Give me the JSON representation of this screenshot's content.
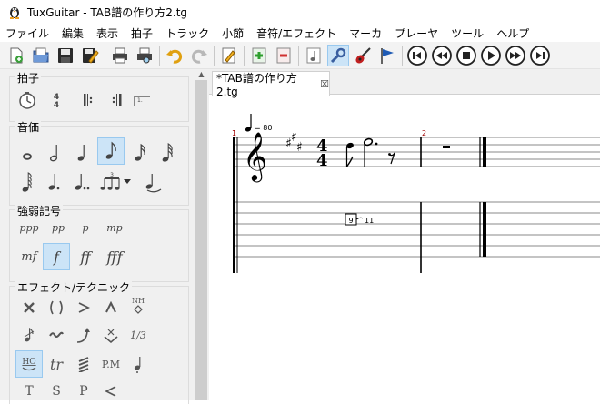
{
  "window": {
    "title": "TuxGuitar - TAB譜の作り方2.tg"
  },
  "menu": [
    "ファイル",
    "編集",
    "表示",
    "拍子",
    "トラック",
    "小節",
    "音符/エフェクト",
    "マーカ",
    "プレーヤ",
    "ツール",
    "ヘルプ"
  ],
  "toolbar": {
    "icons": [
      "new-file-icon",
      "open-file-icon",
      "save-icon",
      "save-as-icon",
      "print-icon",
      "print-preview-icon",
      "undo-icon",
      "redo-icon",
      "edit-mode-icon",
      "add-track-icon",
      "remove-track-icon",
      "transport-icon",
      "tools-icon",
      "guitar-icon",
      "marker-flag-icon",
      "first-icon",
      "previous-icon",
      "stop-icon",
      "play-icon",
      "next-icon",
      "last-icon"
    ]
  },
  "palette": {
    "beat": {
      "title": "拍子"
    },
    "duration": {
      "title": "音価"
    },
    "dynamics": {
      "title": "強弱記号",
      "items": [
        "ppp",
        "pp",
        "p",
        "mp",
        "mf",
        "f",
        "ff",
        "fff"
      ]
    },
    "effects": {
      "title": "エフェクト/テクニック",
      "items": [
        "NH",
        "1/3",
        "HO",
        "tr",
        "P.M",
        "T",
        "S",
        "P"
      ]
    }
  },
  "document": {
    "tab_title": "*TAB譜の作り方2.tg",
    "tempo": "= 80",
    "measure1": "1",
    "measure2": "2",
    "time_top": "4",
    "time_bottom": "4",
    "tab_fret": "9",
    "tab_bend": "11"
  }
}
